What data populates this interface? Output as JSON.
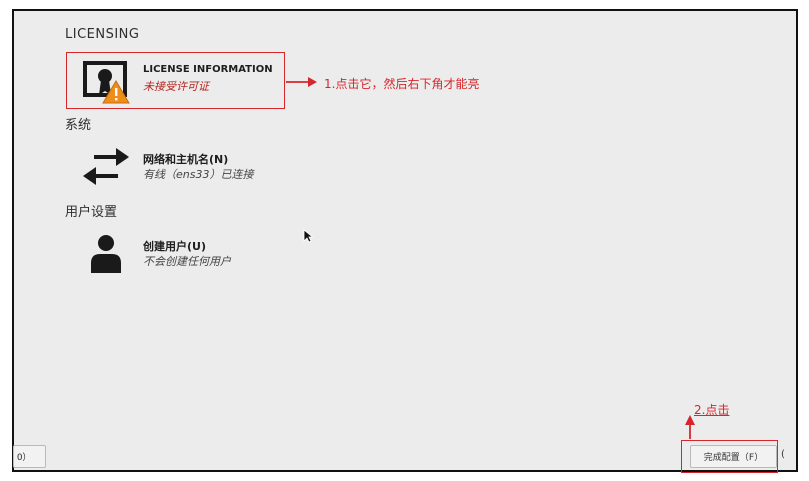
{
  "sections": {
    "licensing": "LICENSING",
    "system": "系统",
    "user_settings": "用户设置"
  },
  "spokes": {
    "license": {
      "title": "LICENSE INFORMATION",
      "status": "未接受许可证",
      "icon": "license-warning-icon"
    },
    "network": {
      "title": "网络和主机名(N)",
      "status": "有线（ens33）已连接",
      "icon": "network-arrows-icon"
    },
    "user": {
      "title": "创建用户(U)",
      "status": "不会创建任何用户",
      "icon": "user-icon"
    }
  },
  "annotations": {
    "step1": "1.点击它，然后右下角才能亮",
    "step2": "2.点击"
  },
  "buttons": {
    "left_partial": "O）",
    "finish": "完成配置（F）",
    "right_partial": "("
  },
  "colors": {
    "annotation": "#d6262b",
    "warning": "#f08c1a",
    "background": "#ececec"
  }
}
